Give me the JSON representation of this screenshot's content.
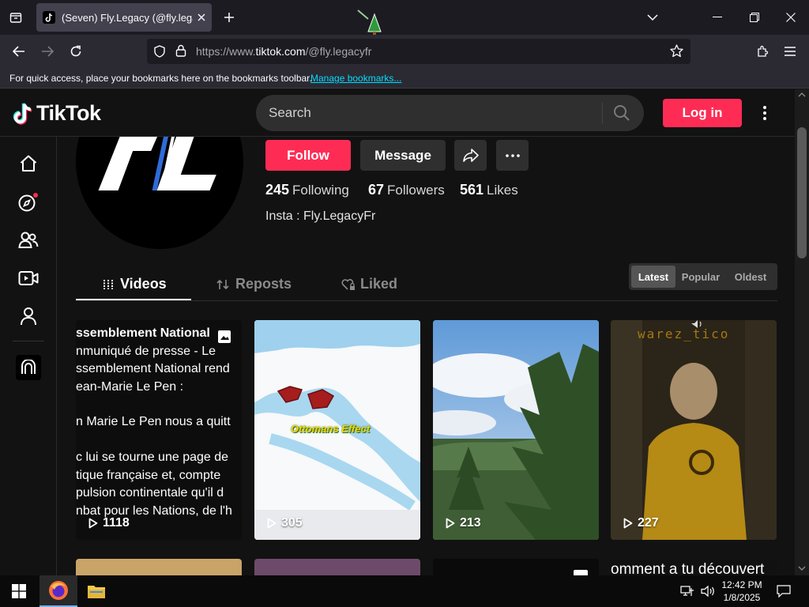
{
  "browser": {
    "tab_title": "(Seven) Fly.Legacy (@fly.legacyfr",
    "url_prefix": "https://www.",
    "url_domain": "tiktok.com",
    "url_path": "/@fly.legacyfr",
    "bookmarks_hint": "For quick access, place your bookmarks here on the bookmarks toolbar.",
    "manage_bookmarks": "Manage bookmarks..."
  },
  "header": {
    "logo_text": "TikTok",
    "search_placeholder": "Search",
    "login_label": "Log in"
  },
  "profile": {
    "avatar_text": "FL",
    "follow_label": "Follow",
    "message_label": "Message",
    "stats": [
      {
        "value": "245",
        "label": "Following"
      },
      {
        "value": "67",
        "label": "Followers"
      },
      {
        "value": "561",
        "label": "Likes"
      }
    ],
    "bio": "Insta : Fly.LegacyFr"
  },
  "tabs": [
    {
      "label": "Videos"
    },
    {
      "label": "Reposts"
    },
    {
      "label": "Liked"
    }
  ],
  "sort": [
    "Latest",
    "Popular",
    "Oldest"
  ],
  "videos": [
    {
      "views": "1118",
      "lines": [
        "ssemblement National",
        "nmuniqué de presse - Le",
        "ssemblement National rend",
        "ean-Marie Le Pen :",
        "",
        "n Marie Le Pen nous a quitt",
        "",
        "c lui se tourne une page de",
        "tique française et, compte",
        "pulsion continentale qu'il d",
        "nbat pour les Nations, de l'h"
      ]
    },
    {
      "views": "305",
      "overlay": "Ottomans Effect"
    },
    {
      "views": "213"
    },
    {
      "views": "227",
      "overlay": "warez_tico"
    }
  ],
  "row2_overlay": "omment a tu découvert",
  "taskbar": {
    "time": "12:42 PM",
    "date": "1/8/2025"
  },
  "colors": {
    "accent": "#fe2c55",
    "background": "#121212",
    "browser_bg": "#2b2a33"
  }
}
